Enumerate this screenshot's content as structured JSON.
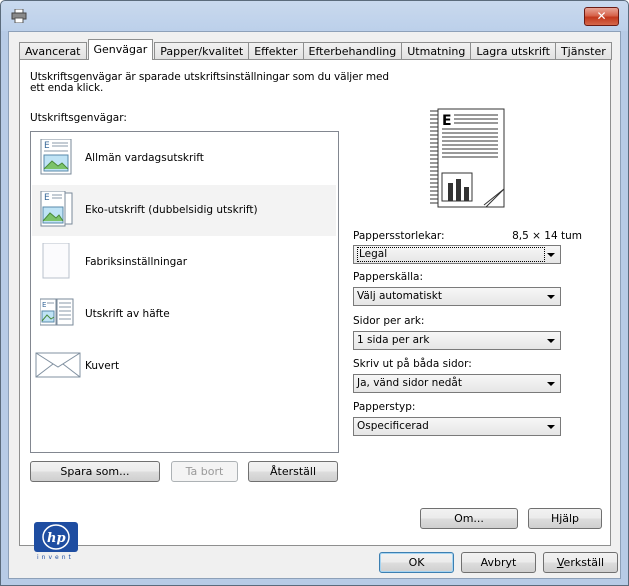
{
  "window": {
    "close_glyph": "✕"
  },
  "tabs": [
    {
      "label": "Avancerat",
      "active": false
    },
    {
      "label": "Genvägar",
      "active": true
    },
    {
      "label": "Papper/kvalitet",
      "active": false
    },
    {
      "label": "Effekter",
      "active": false
    },
    {
      "label": "Efterbehandling",
      "active": false
    },
    {
      "label": "Utmatning",
      "active": false
    },
    {
      "label": "Lagra utskrift",
      "active": false
    },
    {
      "label": "Tjänster",
      "active": false
    }
  ],
  "shortcuts": {
    "description": "Utskriftsgenvägar är sparade utskriftsinställningar som du väljer med ett enda klick.",
    "list_label": "Utskriftsgenvägar:",
    "items": [
      {
        "label": "Allmän vardagsutskrift",
        "icon": "document-landscape-icon"
      },
      {
        "label": "Eko-utskrift (dubbelsidig utskrift)",
        "icon": "duplex-document-icon",
        "selected": true
      },
      {
        "label": "Fabriksinställningar",
        "icon": "blank-page-icon"
      },
      {
        "label": "Utskrift av häfte",
        "icon": "booklet-icon"
      },
      {
        "label": "Kuvert",
        "icon": "envelope-icon"
      }
    ],
    "buttons": {
      "save_as": "Spara som...",
      "delete": "Ta bort",
      "reset": "Återställ"
    }
  },
  "settings": {
    "paper_size_label": "Pappersstorlekar:",
    "paper_size_dims": "8,5 × 14 tum",
    "paper_size_value": "Legal",
    "paper_source_label": "Papperskälla:",
    "paper_source_value": "Välj automatiskt",
    "pages_per_sheet_label": "Sidor per ark:",
    "pages_per_sheet_value": "1 sida per ark",
    "duplex_label": "Skriv ut på båda sidor:",
    "duplex_value": "Ja, vänd sidor nedåt",
    "paper_type_label": "Papperstyp:",
    "paper_type_value": "Ospecificerad"
  },
  "brand": {
    "logo_text": "hp",
    "tagline": "invent",
    "color": "#1e4da1"
  },
  "panel_buttons": {
    "about": "Om...",
    "help": "Hjälp"
  },
  "dialog_buttons": {
    "ok": "OK",
    "cancel": "Avbryt",
    "apply_prefix": "",
    "apply_underlined": "V",
    "apply_rest": "erkställ"
  }
}
